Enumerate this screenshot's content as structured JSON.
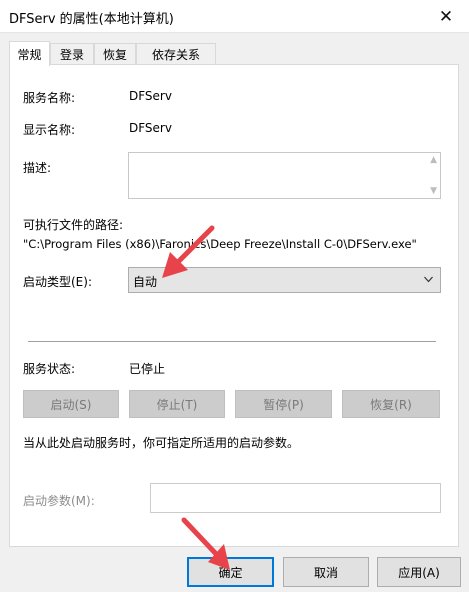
{
  "window": {
    "title": "DFServ 的属性(本地计算机)",
    "close_glyph": "✕"
  },
  "tabs": [
    {
      "label": "常规",
      "active": true
    },
    {
      "label": "登录",
      "active": false
    },
    {
      "label": "恢复",
      "active": false
    },
    {
      "label": "依存关系",
      "active": false
    }
  ],
  "general": {
    "service_name_label": "服务名称:",
    "service_name": "DFServ",
    "display_name_label": "显示名称:",
    "display_name": "DFServ",
    "description_label": "描述:",
    "description": "",
    "exe_path_label": "可执行文件的路径:",
    "exe_path": "\"C:\\Program Files (x86)\\Faronics\\Deep Freeze\\Install C-0\\DFServ.exe\"",
    "startup_type_label": "启动类型(E):",
    "startup_type": "自动",
    "status_label": "服务状态:",
    "status": "已停止",
    "buttons": {
      "start": "启动(S)",
      "stop": "停止(T)",
      "pause": "暂停(P)",
      "resume": "恢复(R)"
    },
    "hint": "当从此处启动服务时，你可指定所适用的启动参数。",
    "start_params_label": "启动参数(M):",
    "start_params_value": ""
  },
  "footer": {
    "ok": "确定",
    "cancel": "取消",
    "apply": "应用(A)"
  },
  "colors": {
    "annotation_arrow": "#e8434a",
    "focus_blue": "#0078d7"
  }
}
